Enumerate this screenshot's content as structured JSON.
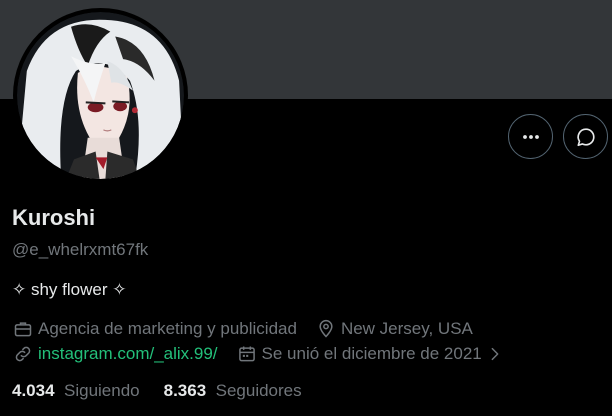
{
  "profile": {
    "name": "Kuroshi",
    "handle": "@e_whelrxmt67fk",
    "bio": "✧ shy flower ✧",
    "category": "Agencia de marketing y publicidad",
    "location": "New Jersey, USA",
    "website": "instagram.com/_alix.99/",
    "joined": "Se unió el diciembre de 2021"
  },
  "stats": {
    "following_count": "4.034",
    "following_label": "Siguiendo",
    "followers_count": "8.363",
    "followers_label": "Seguidores"
  },
  "icons": {
    "more": "more-icon",
    "message": "message-icon",
    "category": "briefcase-icon",
    "location": "location-pin-icon",
    "website": "link-icon",
    "joined": "calendar-icon",
    "joined_expand": "chevron-right-icon"
  },
  "colors": {
    "banner": "#333639",
    "background": "#000000",
    "primary_text": "#e7e9ea",
    "secondary_text": "#71767b",
    "link": "#23c07a",
    "button_border": "#536471"
  }
}
